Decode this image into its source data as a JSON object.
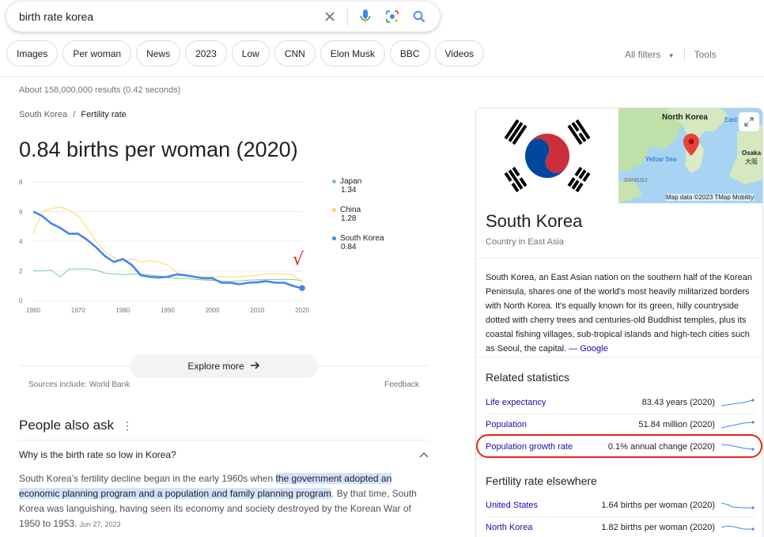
{
  "search": {
    "query": "birth rate korea"
  },
  "chips": [
    "Images",
    "Per woman",
    "News",
    "2023",
    "Low",
    "CNN",
    "Elon Musk",
    "BBC",
    "Videos"
  ],
  "filters": {
    "all_filters": "All filters",
    "tools": "Tools"
  },
  "result_stats": "About 158,000,000 results (0.42 seconds)",
  "breadcrumb": {
    "parent": "South Korea",
    "sep": "/",
    "current": "Fertility rate"
  },
  "headline": "0.84 births per woman (2020)",
  "chart_data": {
    "type": "line",
    "x": [
      1960,
      1962,
      1964,
      1966,
      1968,
      1970,
      1972,
      1974,
      1976,
      1978,
      1980,
      1982,
      1984,
      1986,
      1988,
      1990,
      1992,
      1994,
      1996,
      1998,
      2000,
      2002,
      2004,
      2006,
      2008,
      2010,
      2012,
      2014,
      2016,
      2018,
      2020
    ],
    "series": [
      {
        "name": "Japan",
        "color": "#81c995",
        "last_label": "1.34",
        "values": [
          2.0,
          2.0,
          2.05,
          1.58,
          2.13,
          2.13,
          2.14,
          2.05,
          1.85,
          1.79,
          1.75,
          1.77,
          1.81,
          1.72,
          1.66,
          1.54,
          1.5,
          1.5,
          1.43,
          1.38,
          1.36,
          1.32,
          1.29,
          1.32,
          1.37,
          1.39,
          1.41,
          1.42,
          1.44,
          1.42,
          1.34
        ]
      },
      {
        "name": "China",
        "color": "#fdd663",
        "last_label": "1.28",
        "values": [
          4.5,
          6.0,
          6.2,
          6.3,
          6.1,
          5.7,
          4.9,
          4.0,
          3.3,
          2.9,
          2.6,
          2.8,
          2.6,
          2.7,
          2.6,
          2.4,
          1.9,
          1.7,
          1.6,
          1.6,
          1.6,
          1.6,
          1.6,
          1.6,
          1.65,
          1.7,
          1.8,
          1.8,
          1.8,
          1.7,
          1.28
        ]
      },
      {
        "name": "South Korea",
        "color": "#4285f4",
        "last_label": "0.84",
        "values": [
          6.0,
          5.7,
          5.2,
          4.9,
          4.5,
          4.5,
          4.1,
          3.6,
          3.0,
          2.6,
          2.8,
          2.4,
          1.7,
          1.6,
          1.55,
          1.6,
          1.76,
          1.7,
          1.6,
          1.5,
          1.5,
          1.2,
          1.2,
          1.1,
          1.2,
          1.23,
          1.3,
          1.2,
          1.2,
          0.98,
          0.84
        ]
      }
    ],
    "ylim": [
      0,
      8
    ],
    "yticks": [
      0,
      2,
      4,
      6,
      8
    ],
    "xticks": [
      1960,
      1970,
      1980,
      1990,
      2000,
      2010,
      2020
    ],
    "grid": true
  },
  "explore": {
    "label": "Explore more"
  },
  "sources": "Sources include: World Bank",
  "feedback": "Feedback",
  "paa": {
    "title": "People also ask",
    "question": "Why is the birth rate so low in Korea?",
    "answer_pre": "South Korea's fertility decline began in the early 1960s when ",
    "answer_hl": "the government adopted an economic planning program and a population and family planning program",
    "answer_post": ". By that time, South Korea was languishing, having seen its economy and society destroyed by the Korean War of 1950 to 1953.",
    "date": "Jun 27, 2023"
  },
  "kp": {
    "map": {
      "north_korea": "North Korea",
      "east": "East S",
      "yellow_sea": "Yellow Sea",
      "osaka": "Osaka",
      "osaka_jp": "大阪",
      "jiangsu": "JIANGSU",
      "credit": "Map data ©2023 TMap Mobility"
    },
    "title": "South Korea",
    "subtitle": "Country in East Asia",
    "description": "South Korea, an East Asian nation on the southern half of the Korean Peninsula, shares one of the world's most heavily militarized borders with North Korea. It's equally known for its green, hilly countryside dotted with cherry trees and centuries-old Buddhist temples, plus its coastal fishing villages, sub-tropical islands and high-tech cities such as Seoul, the capital.",
    "desc_source": "— Google",
    "related_title": "Related statistics",
    "related": [
      {
        "label": "Life expectancy",
        "value": "83.43 years (2020)"
      },
      {
        "label": "Population",
        "value": "51.84 million (2020)"
      },
      {
        "label": "Population growth rate",
        "value": "0.1% annual change (2020)"
      }
    ],
    "elsewhere_title": "Fertility rate elsewhere",
    "elsewhere": [
      {
        "label": "United States",
        "value": "1.64 births per woman (2020)"
      },
      {
        "label": "North Korea",
        "value": "1.82 births per woman (2020)"
      }
    ]
  },
  "annotation_check": "√"
}
